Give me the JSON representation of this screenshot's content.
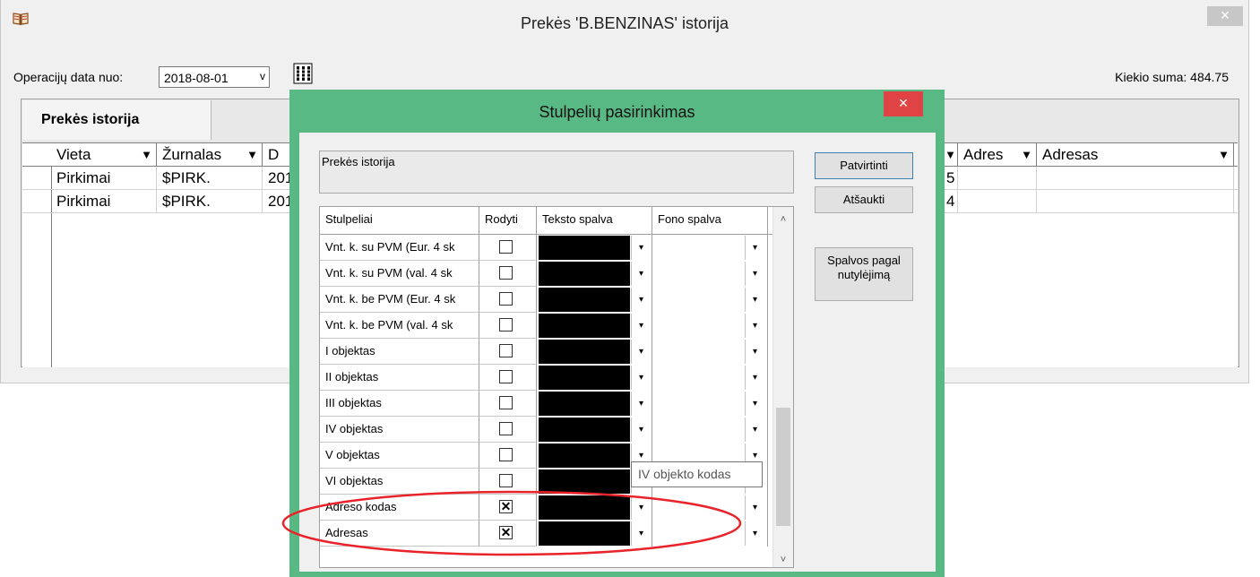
{
  "main_window": {
    "title": "Prekės 'B.BENZINAS' istorija",
    "close_label": "×",
    "operation_date_label": "Operacijų data nuo:",
    "operation_date_value": "2018-08-01",
    "dropdown_arrow": "v",
    "quantity_sum_label": "Kiekio suma: 484.75",
    "tab_label": "Prekės istorija",
    "grid": {
      "headers": [
        {
          "label": "Vieta",
          "arrow": "▼"
        },
        {
          "label": "Žurnalas",
          "arrow": "▼"
        },
        {
          "label": "D",
          "arrow": ""
        },
        {
          "label": "",
          "arrow": "▼"
        },
        {
          "label": "Adres",
          "arrow": "▼"
        },
        {
          "label": "Adresas",
          "arrow": "▼"
        }
      ],
      "rows": [
        {
          "vieta": "Pirkimai",
          "zurnalas": "$PIRK.",
          "data": "201",
          "tail": "5"
        },
        {
          "vieta": "Pirkimai",
          "zurnalas": "$PIRK.",
          "data": "201",
          "tail": "4"
        }
      ]
    }
  },
  "dialog": {
    "title": "Stulpelių pasirinkimas",
    "close_label": "×",
    "group_label": "Prekės istorija",
    "buttons": {
      "confirm": "Patvirtinti",
      "cancel": "Atšaukti",
      "default_colors": "Spalvos pagal nutylėjimą"
    },
    "table_headers": {
      "columns": "Stulpeliai",
      "show": "Rodyti",
      "text_color": "Teksto spalva",
      "bg_color": "Fono spalva"
    },
    "rows": [
      {
        "name": "Vnt. k. su PVM (Eur. 4 sk",
        "checked": false
      },
      {
        "name": "Vnt. k. su PVM (val. 4 sk",
        "checked": false
      },
      {
        "name": "Vnt. k. be PVM (Eur. 4 sk",
        "checked": false
      },
      {
        "name": "Vnt. k. be PVM (val. 4 sk",
        "checked": false
      },
      {
        "name": "I objektas",
        "checked": false
      },
      {
        "name": "II objektas",
        "checked": false
      },
      {
        "name": "III objektas",
        "checked": false
      },
      {
        "name": "IV objektas",
        "checked": false
      },
      {
        "name": "V objektas",
        "checked": false
      },
      {
        "name": "VI objektas",
        "checked": false
      },
      {
        "name": "Adreso kodas",
        "checked": true
      },
      {
        "name": "Adresas",
        "checked": true
      }
    ],
    "check_mark": "✕",
    "dropdown_arrow": "▾",
    "scroll_up": "˄",
    "scroll_down": "˅",
    "tooltip": "IV objekto kodas"
  },
  "colors": {
    "dialog_frame": "#58b984",
    "close_button": "#e04343",
    "annotation": "#e8232a",
    "text_color_swatch": "#000000"
  },
  "icons": {
    "app": "open-book-icon",
    "columns": "column-chooser-icon"
  }
}
